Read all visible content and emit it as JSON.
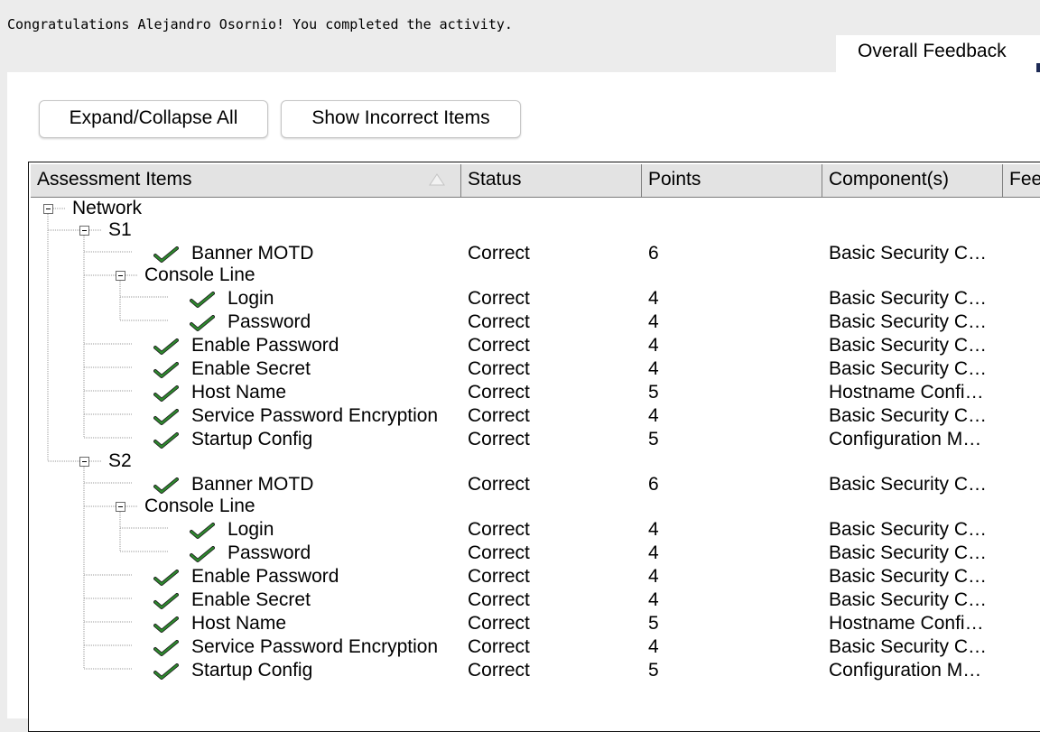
{
  "header": {
    "congrats_text": "Congratulations Alejandro Osornio! You completed the activity.",
    "overall_tab_label": "Overall Feedback"
  },
  "toolbar": {
    "expand_label": "Expand/Collapse All",
    "incorrect_label": "Show Incorrect Items"
  },
  "table": {
    "columns": [
      "Assessment Items",
      "Status",
      "Points",
      "Component(s)",
      "Fee"
    ],
    "sorted_column": "Assessment Items",
    "rows": [
      {
        "label": "Network",
        "level": 0,
        "kind": "group"
      },
      {
        "label": "S1",
        "level": 1,
        "kind": "group"
      },
      {
        "label": "Banner MOTD",
        "level": 2,
        "kind": "item",
        "status": "Correct",
        "points": "6",
        "component": "Basic Security C…"
      },
      {
        "label": "Console Line",
        "level": 2,
        "kind": "group"
      },
      {
        "label": "Login",
        "level": 3,
        "kind": "item",
        "status": "Correct",
        "points": "4",
        "component": "Basic Security C…"
      },
      {
        "label": "Password",
        "level": 3,
        "kind": "item",
        "status": "Correct",
        "points": "4",
        "component": "Basic Security C…"
      },
      {
        "label": "Enable Password",
        "level": 2,
        "kind": "item",
        "status": "Correct",
        "points": "4",
        "component": "Basic Security C…"
      },
      {
        "label": "Enable Secret",
        "level": 2,
        "kind": "item",
        "status": "Correct",
        "points": "4",
        "component": "Basic Security C…"
      },
      {
        "label": "Host Name",
        "level": 2,
        "kind": "item",
        "status": "Correct",
        "points": "5",
        "component": "Hostname Confi…"
      },
      {
        "label": "Service Password Encryption",
        "level": 2,
        "kind": "item",
        "status": "Correct",
        "points": "4",
        "component": "Basic Security C…"
      },
      {
        "label": "Startup Config",
        "level": 2,
        "kind": "item",
        "status": "Correct",
        "points": "5",
        "component": "Configuration M…"
      },
      {
        "label": "S2",
        "level": 1,
        "kind": "group"
      },
      {
        "label": "Banner MOTD",
        "level": 2,
        "kind": "item",
        "status": "Correct",
        "points": "6",
        "component": "Basic Security C…"
      },
      {
        "label": "Console Line",
        "level": 2,
        "kind": "group"
      },
      {
        "label": "Login",
        "level": 3,
        "kind": "item",
        "status": "Correct",
        "points": "4",
        "component": "Basic Security C…"
      },
      {
        "label": "Password",
        "level": 3,
        "kind": "item",
        "status": "Correct",
        "points": "4",
        "component": "Basic Security C…"
      },
      {
        "label": "Enable Password",
        "level": 2,
        "kind": "item",
        "status": "Correct",
        "points": "4",
        "component": "Basic Security C…"
      },
      {
        "label": "Enable Secret",
        "level": 2,
        "kind": "item",
        "status": "Correct",
        "points": "4",
        "component": "Basic Security C…"
      },
      {
        "label": "Host Name",
        "level": 2,
        "kind": "item",
        "status": "Correct",
        "points": "5",
        "component": "Hostname Confi…"
      },
      {
        "label": "Service Password Encryption",
        "level": 2,
        "kind": "item",
        "status": "Correct",
        "points": "4",
        "component": "Basic Security C…"
      },
      {
        "label": "Startup Config",
        "level": 2,
        "kind": "item",
        "status": "Correct",
        "points": "5",
        "component": "Configuration M…"
      }
    ]
  },
  "icons": {
    "expand": "collapse-minus-icon",
    "item": "green-check-icon",
    "sort": "sort-ascending-icon"
  },
  "colors": {
    "page_bg": "#ececec",
    "panel_bg": "#ffffff",
    "header_bg": "#e3e3e3",
    "check_green": "#2e8b2e",
    "tab_accent": "#1d2a55"
  }
}
